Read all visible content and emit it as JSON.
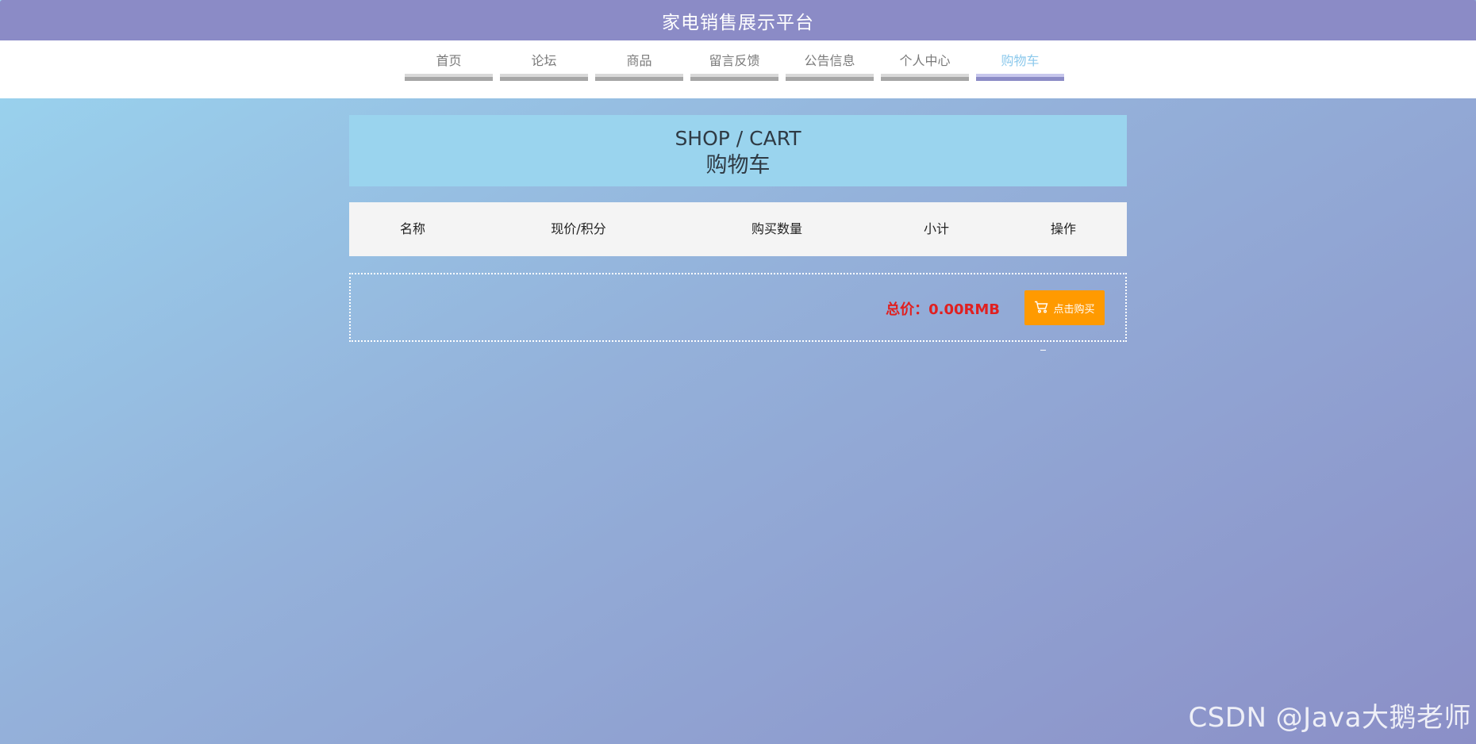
{
  "header": {
    "title": "家电销售展示平台"
  },
  "nav": {
    "items": [
      {
        "label": "首页",
        "active": false
      },
      {
        "label": "论坛",
        "active": false
      },
      {
        "label": "商品",
        "active": false
      },
      {
        "label": "留言反馈",
        "active": false
      },
      {
        "label": "公告信息",
        "active": false
      },
      {
        "label": "个人中心",
        "active": false
      },
      {
        "label": "购物车",
        "active": true
      }
    ],
    "active_color": "#8cc9ec"
  },
  "banner": {
    "title_en": "SHOP / CART",
    "title_cn": "购物车"
  },
  "cart_table": {
    "columns": [
      "名称",
      "现价/积分",
      "购买数量",
      "小计",
      "操作"
    ]
  },
  "total": {
    "label": "总价：0.00RMB"
  },
  "buy_button": {
    "label": "点击购买",
    "icon": "cart-icon",
    "color": "#ff9a00"
  },
  "watermark": {
    "text": "CSDN @Java大鹅老师"
  },
  "colors": {
    "header_bg": "#8b8bc6",
    "banner_bg": "#9ad4ee",
    "total_color": "#e02020"
  }
}
